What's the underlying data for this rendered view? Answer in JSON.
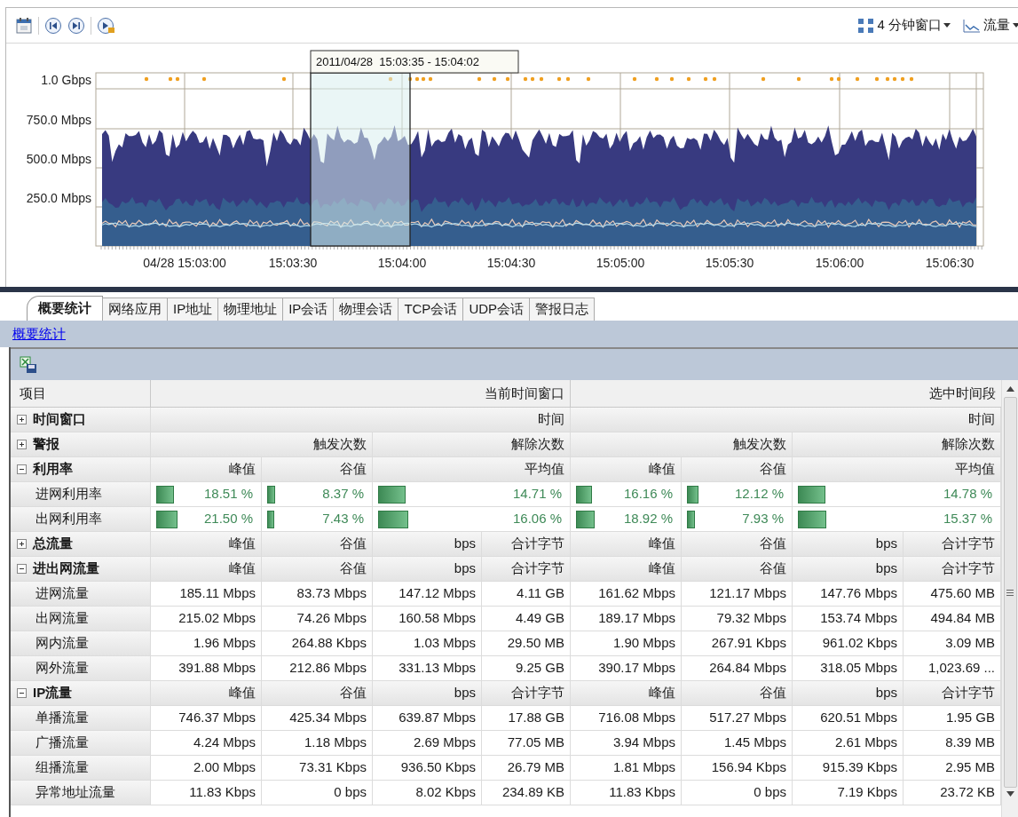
{
  "toolbar": {
    "window_menu": "4 分钟窗口",
    "metric_menu": "流量"
  },
  "chart": {
    "selection_label": "2011/04/28  15:03:35 - 15:04:02",
    "y_labels": [
      "1.0 Gbps",
      "750.0 Mbps",
      "500.0 Mbps",
      "250.0 Mbps"
    ],
    "x_labels": [
      "04/28 15:03:00",
      "15:03:30",
      "15:04:00",
      "15:04:30",
      "15:05:00",
      "15:05:30",
      "15:06:00",
      "15:06:30"
    ]
  },
  "tabs": [
    {
      "label": "概要统计",
      "selected": true
    },
    {
      "label": "网络应用",
      "selected": false
    },
    {
      "label": "IP地址",
      "selected": false
    },
    {
      "label": "物理地址",
      "selected": false
    },
    {
      "label": "IP会话",
      "selected": false
    },
    {
      "label": "物理会话",
      "selected": false
    },
    {
      "label": "TCP会话",
      "selected": false
    },
    {
      "label": "UDP会话",
      "selected": false
    },
    {
      "label": "警报日志",
      "selected": false
    }
  ],
  "breadcrumb": "概要统计",
  "table": {
    "columns": {
      "item": "项目",
      "current": "当前时间窗口",
      "selected": "选中时间段"
    },
    "rows": [
      {
        "kind": "group",
        "label": "时间窗口",
        "expanded": false,
        "current": [
          "时间"
        ],
        "selected": [
          "时间"
        ]
      },
      {
        "kind": "group",
        "label": "警报",
        "expanded": false,
        "current": [
          "触发次数",
          "解除次数"
        ],
        "selected": [
          "触发次数",
          "解除次数"
        ]
      },
      {
        "kind": "group",
        "label": "利用率",
        "expanded": true,
        "current": [
          "峰值",
          "谷值",
          "平均值"
        ],
        "selected": [
          "峰值",
          "谷值",
          "平均值"
        ]
      },
      {
        "kind": "meter",
        "label": "进网利用率",
        "current": [
          {
            "text": "18.51 %",
            "level": 0.1851
          },
          {
            "text": "8.37 %",
            "level": 0.0837
          },
          {
            "text": "14.71 %",
            "level": 0.1471
          }
        ],
        "selected": [
          {
            "text": "16.16 %",
            "level": 0.1616
          },
          {
            "text": "12.12 %",
            "level": 0.1212
          },
          {
            "text": "14.78 %",
            "level": 0.1478
          }
        ]
      },
      {
        "kind": "meter",
        "label": "出网利用率",
        "current": [
          {
            "text": "21.50 %",
            "level": 0.215
          },
          {
            "text": "7.43 %",
            "level": 0.0743
          },
          {
            "text": "16.06 %",
            "level": 0.1606
          }
        ],
        "selected": [
          {
            "text": "18.92 %",
            "level": 0.1892
          },
          {
            "text": "7.93 %",
            "level": 0.0793
          },
          {
            "text": "15.37 %",
            "level": 0.1537
          }
        ]
      },
      {
        "kind": "group",
        "label": "总流量",
        "expanded": false,
        "current": [
          "峰值",
          "谷值",
          "bps",
          "合计字节"
        ],
        "selected": [
          "峰值",
          "谷值",
          "bps",
          "合计字节"
        ]
      },
      {
        "kind": "group",
        "label": "进出网流量",
        "expanded": true,
        "current": [
          "峰值",
          "谷值",
          "bps",
          "合计字节"
        ],
        "selected": [
          "峰值",
          "谷值",
          "bps",
          "合计字节"
        ]
      },
      {
        "kind": "data",
        "label": "进网流量",
        "current": [
          "185.11 Mbps",
          "83.73 Mbps",
          "147.12 Mbps",
          "4.11 GB"
        ],
        "selected": [
          "161.62 Mbps",
          "121.17 Mbps",
          "147.76 Mbps",
          "475.60 MB"
        ]
      },
      {
        "kind": "data",
        "label": "出网流量",
        "current": [
          "215.02 Mbps",
          "74.26 Mbps",
          "160.58 Mbps",
          "4.49 GB"
        ],
        "selected": [
          "189.17 Mbps",
          "79.32 Mbps",
          "153.74 Mbps",
          "494.84 MB"
        ]
      },
      {
        "kind": "data",
        "label": "网内流量",
        "current": [
          "1.96 Mbps",
          "264.88 Kbps",
          "1.03 Mbps",
          "29.50 MB"
        ],
        "selected": [
          "1.90 Mbps",
          "267.91 Kbps",
          "961.02 Kbps",
          "3.09 MB"
        ]
      },
      {
        "kind": "data",
        "label": "网外流量",
        "current": [
          "391.88 Mbps",
          "212.86 Mbps",
          "331.13 Mbps",
          "9.25 GB"
        ],
        "selected": [
          "390.17 Mbps",
          "264.84 Mbps",
          "318.05 Mbps",
          "1,023.69 ..."
        ]
      },
      {
        "kind": "group",
        "label": "IP流量",
        "expanded": true,
        "current": [
          "峰值",
          "谷值",
          "bps",
          "合计字节"
        ],
        "selected": [
          "峰值",
          "谷值",
          "bps",
          "合计字节"
        ]
      },
      {
        "kind": "data",
        "label": "单播流量",
        "current": [
          "746.37 Mbps",
          "425.34 Mbps",
          "639.87 Mbps",
          "17.88 GB"
        ],
        "selected": [
          "716.08 Mbps",
          "517.27 Mbps",
          "620.51 Mbps",
          "1.95 GB"
        ]
      },
      {
        "kind": "data",
        "label": "广播流量",
        "current": [
          "4.24 Mbps",
          "1.18 Mbps",
          "2.69 Mbps",
          "77.05 MB"
        ],
        "selected": [
          "3.94 Mbps",
          "1.45 Mbps",
          "2.61 Mbps",
          "8.39 MB"
        ]
      },
      {
        "kind": "data",
        "label": "组播流量",
        "current": [
          "2.00 Mbps",
          "73.31 Kbps",
          "936.50 Kbps",
          "26.79 MB"
        ],
        "selected": [
          "1.81 Mbps",
          "156.94 Kbps",
          "915.39 Kbps",
          "2.95 MB"
        ]
      },
      {
        "kind": "data",
        "label": "异常地址流量",
        "current": [
          "11.83 Kbps",
          "0 bps",
          "8.02 Kbps",
          "234.89 KB"
        ],
        "selected": [
          "11.83 Kbps",
          "0 bps",
          "7.19 Kbps",
          "23.72 KB"
        ]
      }
    ]
  }
}
